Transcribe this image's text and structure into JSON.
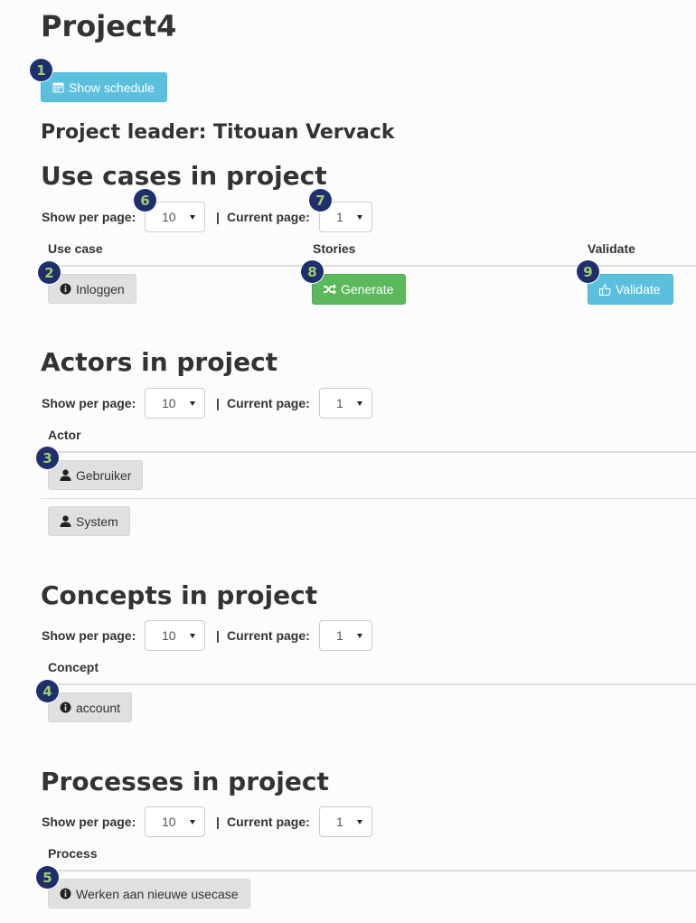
{
  "page": {
    "title": "Project4",
    "project_leader": "Project leader: Titouan Vervack"
  },
  "schedule_button": {
    "label": "Show schedule",
    "icon": "calendar-icon"
  },
  "paging": {
    "show_per_page_label": "Show per page:",
    "current_page_label": "Current page:",
    "separator": "|"
  },
  "use_cases": {
    "heading": "Use cases in project",
    "per_page": "10",
    "current_page": "1",
    "columns": [
      "Use case",
      "Stories",
      "Validate"
    ],
    "rows": [
      {
        "name": "Inloggen",
        "icon": "info-circle-icon",
        "generate_label": "Generate",
        "validate_label": "Validate"
      }
    ]
  },
  "actors": {
    "heading": "Actors in project",
    "per_page": "10",
    "current_page": "1",
    "columns": [
      "Actor"
    ],
    "rows": [
      {
        "name": "Gebruiker",
        "icon": "user-icon"
      },
      {
        "name": "System",
        "icon": "user-icon"
      }
    ]
  },
  "concepts": {
    "heading": "Concepts in project",
    "per_page": "10",
    "current_page": "1",
    "columns": [
      "Concept"
    ],
    "rows": [
      {
        "name": "account",
        "icon": "info-circle-icon"
      }
    ]
  },
  "processes": {
    "heading": "Processes in project",
    "per_page": "10",
    "current_page": "1",
    "columns": [
      "Process"
    ],
    "rows": [
      {
        "name": "Werken aan nieuwe usecase",
        "icon": "info-circle-icon"
      }
    ]
  },
  "annotations": [
    "1",
    "2",
    "3",
    "4",
    "5",
    "6",
    "7",
    "8",
    "9"
  ],
  "colors": {
    "info": "#5bc0de",
    "success": "#5cb85c",
    "default": "#e0e0e0",
    "badge": "#1f2f6e",
    "badge_text": "#9fd06a"
  }
}
